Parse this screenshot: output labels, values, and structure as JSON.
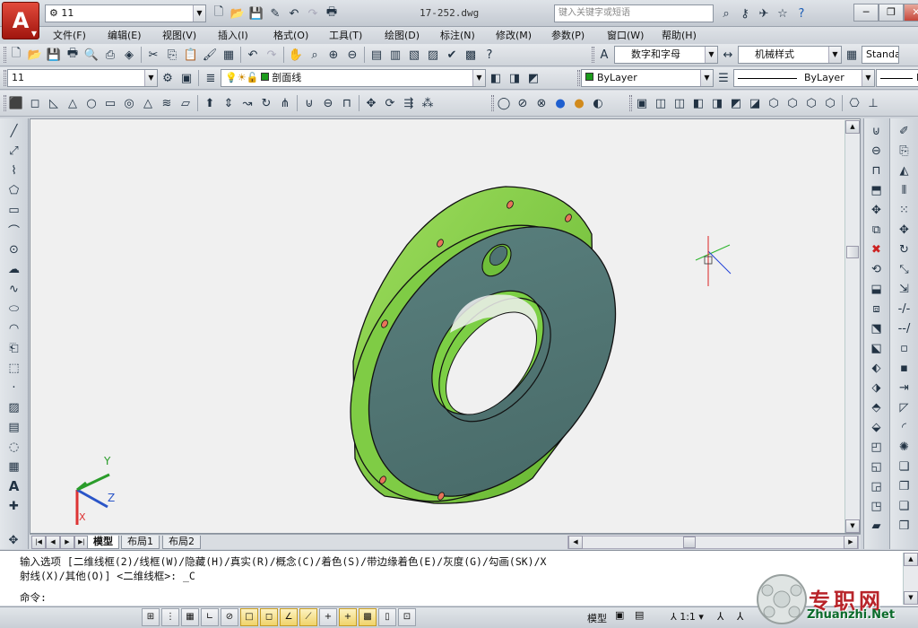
{
  "app": {
    "title": "17-252.dwg",
    "logo_letter": "A",
    "workspace": "11",
    "search_placeholder": "键入关键字或短语"
  },
  "menu": [
    "文件(F)",
    "编辑(E)",
    "视图(V)",
    "插入(I)",
    "格式(O)",
    "工具(T)",
    "绘图(D)",
    "标注(N)",
    "修改(M)",
    "参数(P)",
    "窗口(W)",
    "帮助(H)"
  ],
  "styles": {
    "text_style": "数字和字母",
    "dim_style": "机械样式",
    "table_style": "Standa"
  },
  "layers": {
    "layer_state": "11",
    "current_layer": "剖面线",
    "color": "ByLayer",
    "linetype": "ByLayer",
    "lineweight": "B"
  },
  "tabs": [
    "模型",
    "布局1",
    "布局2"
  ],
  "command": {
    "line1": "输入选项 [二维线框(2)/线框(W)/隐藏(H)/真实(R)/概念(C)/着色(S)/带边缘着色(E)/灰度(G)/勾画(SK)/X",
    "line2": "射线(X)/其他(O)] <二维线框>: _C",
    "prompt": "命令:"
  },
  "status": {
    "space": "模型",
    "annotation_scale": "1:1"
  },
  "ucs": {
    "x": "X",
    "y": "Y",
    "z": "Z"
  },
  "watermark": {
    "text": "专职网",
    "url": "Zhuanzhi.Net"
  },
  "colors": {
    "part_green": "#86d24a",
    "part_face": "#4f7472",
    "hole": "#e8745a",
    "background": "#f0f0f0"
  }
}
